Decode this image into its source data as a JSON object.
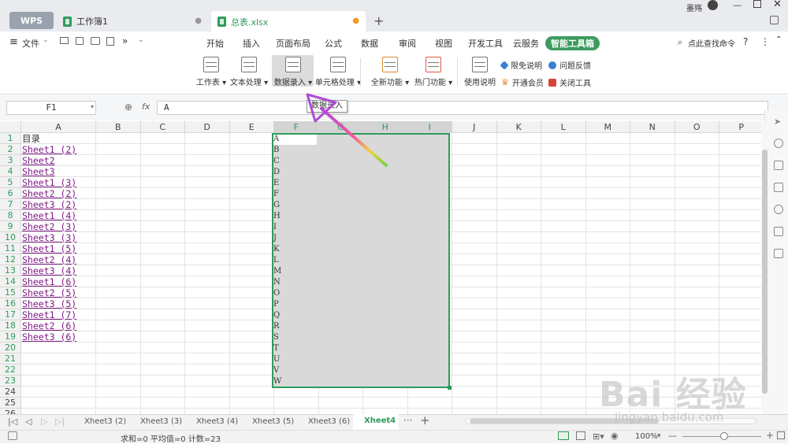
{
  "titlebar": {
    "app_tab": "WPS",
    "doc_tab": "工作簿1",
    "active_tab": "总表.xlsx",
    "user": "墨殇"
  },
  "menu": {
    "file": "文件",
    "items": [
      "开始",
      "插入",
      "页面布局",
      "公式",
      "数据",
      "审阅",
      "视图",
      "开发工具",
      "云服务",
      "智能工具箱"
    ],
    "search": "点此查找命令"
  },
  "ribbon": {
    "buttons": [
      "工作表",
      "文本处理",
      "数据录入",
      "单元格处理",
      "全新功能",
      "热门功能",
      "使用说明"
    ],
    "side": [
      "限免说明",
      "问题反馈",
      "开通会员",
      "关闭工具"
    ]
  },
  "tooltip": "数据录入",
  "formula": {
    "namebox": "F1",
    "fx": "fx",
    "value": "A"
  },
  "columns": [
    "A",
    "B",
    "C",
    "D",
    "E",
    "F",
    "G",
    "H",
    "I",
    "J",
    "K",
    "L",
    "M",
    "N",
    "O",
    "P"
  ],
  "rows": [
    "1",
    "2",
    "3",
    "4",
    "5",
    "6",
    "7",
    "8",
    "9",
    "10",
    "11",
    "12",
    "13",
    "14",
    "15",
    "16",
    "17",
    "18",
    "19",
    "20",
    "21",
    "22",
    "23",
    "24",
    "25",
    "26"
  ],
  "colA": [
    "目录",
    "Sheet1 (2)",
    "Sheet2",
    "Sheet3",
    "Sheet1 (3)",
    "Sheet2 (2)",
    "Sheet3 (2)",
    "Sheet1 (4)",
    "Sheet2 (3)",
    "Sheet3 (3)",
    "Sheet1 (5)",
    "Sheet2 (4)",
    "Sheet3 (4)",
    "Sheet1 (6)",
    "Sheet2 (5)",
    "Sheet3 (5)",
    "Sheet1 (7)",
    "Sheet2 (6)",
    "Sheet3 (6)"
  ],
  "colF": [
    "A",
    "B",
    "C",
    "D",
    "E",
    "F",
    "G",
    "H",
    "I",
    "J",
    "K",
    "L",
    "M",
    "N",
    "O",
    "P",
    "Q",
    "R",
    "S",
    "T",
    "U",
    "V",
    "W"
  ],
  "sheets": [
    "Xheet3 (2)",
    "Xheet3 (3)",
    "Xheet3 (4)",
    "Xheet3 (5)",
    "Xheet3 (6)",
    "Xheet4"
  ],
  "status": {
    "summary": "求和=0  平均值=0  计数=23",
    "zoom": "100%"
  },
  "watermark": {
    "brand": "Bai 经验",
    "url": "jingyan.baidu.com"
  },
  "colors": {
    "accent": "#2e9c5b",
    "link": "#7d1b83",
    "selection": "#d9d9d9"
  }
}
